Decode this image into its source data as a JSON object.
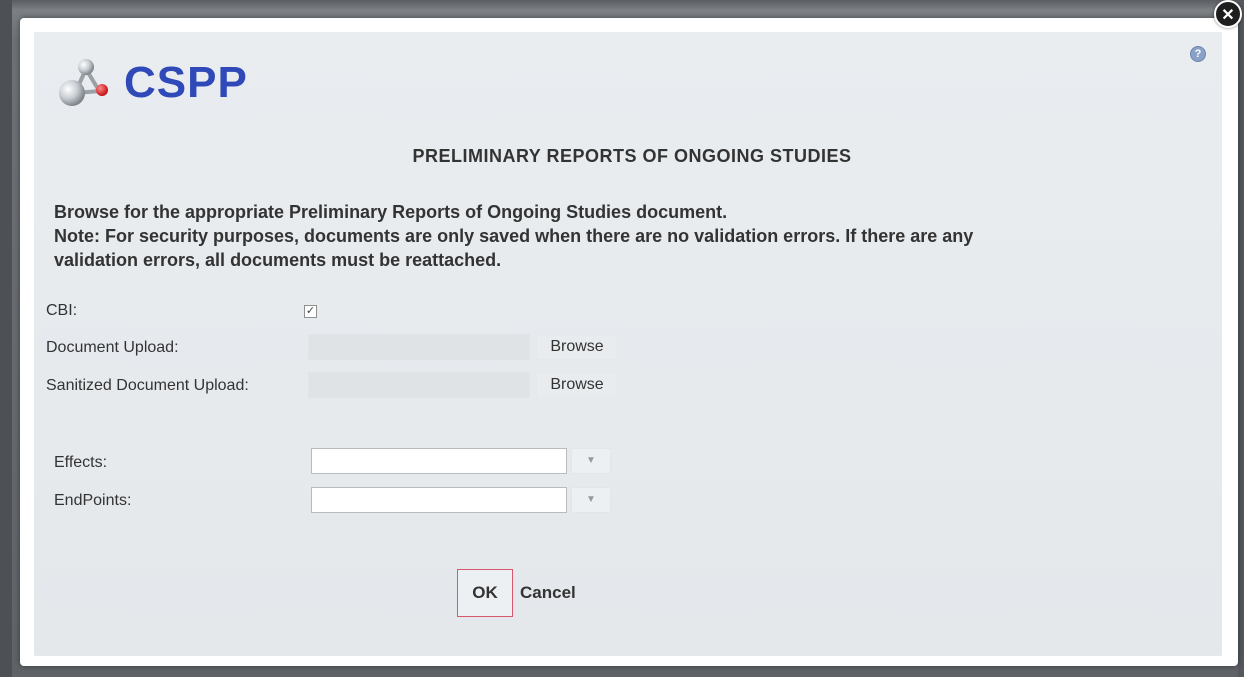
{
  "app": {
    "logo_text": "CSPP"
  },
  "dialog": {
    "title": "PRELIMINARY REPORTS OF ONGOING STUDIES",
    "instruction_line1": "Browse for the appropriate Preliminary Reports of Ongoing Studies document.",
    "instruction_line2": "Note: For security purposes, documents are only saved when there are no validation errors. If there are any\nvalidation errors, all documents must be reattached.",
    "close_icon": "close-icon",
    "help_icon": "help-icon"
  },
  "form": {
    "cbi_label": "CBI:",
    "cbi_checked": true,
    "document_upload_label": "Document Upload:",
    "document_upload_value": "",
    "document_browse_label": "Browse",
    "sanitized_upload_label": "Sanitized Document Upload:",
    "sanitized_upload_value": "",
    "sanitized_browse_label": "Browse",
    "effects_label": "Effects:",
    "effects_value": "",
    "endpoints_label": "EndPoints:",
    "endpoints_value": ""
  },
  "actions": {
    "ok_label": "OK",
    "cancel_label": "Cancel"
  },
  "colors": {
    "brand": "#2f49b8",
    "ok_border": "#d9566f"
  }
}
